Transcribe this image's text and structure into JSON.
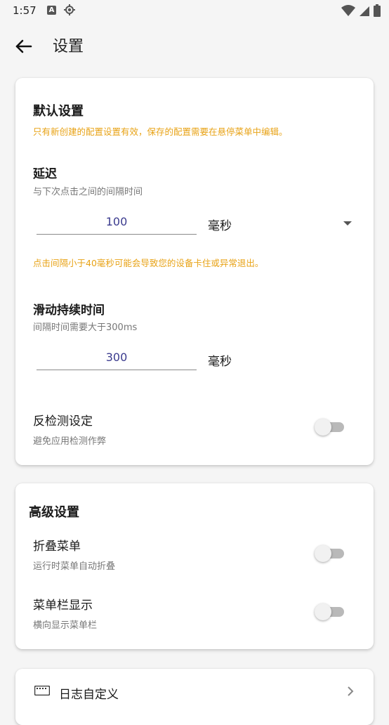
{
  "status_bar": {
    "time": "1:57",
    "a_badge": "A",
    "icons": [
      "a-badge-icon",
      "gps-icon",
      "wifi-icon",
      "signal-icon",
      "battery-icon"
    ]
  },
  "app_bar": {
    "title": "设置",
    "back_icon": "arrow-left-icon"
  },
  "default_settings": {
    "title": "默认设置",
    "notice": "只有新创建的配置设置有效，保存的配置需要在悬停菜单中编辑。",
    "delay": {
      "title": "延迟",
      "subtitle": "与下次点击之间的间隔时间",
      "value": "100",
      "unit": "毫秒",
      "warning": "点击间隔小于40毫秒可能会导致您的设备卡住或异常退出。"
    },
    "swipe_duration": {
      "title": "滑动持续时间",
      "subtitle": "间隔时间需要大于300ms",
      "value": "300",
      "unit": "毫秒"
    },
    "anti_detection": {
      "title": "反检测设定",
      "subtitle": "避免应用检测作弊",
      "enabled": false
    }
  },
  "advanced_settings": {
    "title": "高级设置",
    "fold_menu": {
      "title": "折叠菜单",
      "subtitle": "运行时菜单自动折叠",
      "enabled": false
    },
    "menu_bar_display": {
      "title": "菜单栏显示",
      "subtitle": "横向显示菜单栏",
      "enabled": false
    }
  },
  "third_card": {
    "item_label": "日志自定义",
    "icon": "keyboard-icon",
    "chevron_icon": "chevron-right-icon"
  },
  "colors": {
    "notice": "#e8a317",
    "input_text": "#3b3b8e",
    "toggle_track_off": "#b9b9b9",
    "toggle_thumb_off": "#f1f1f1"
  }
}
